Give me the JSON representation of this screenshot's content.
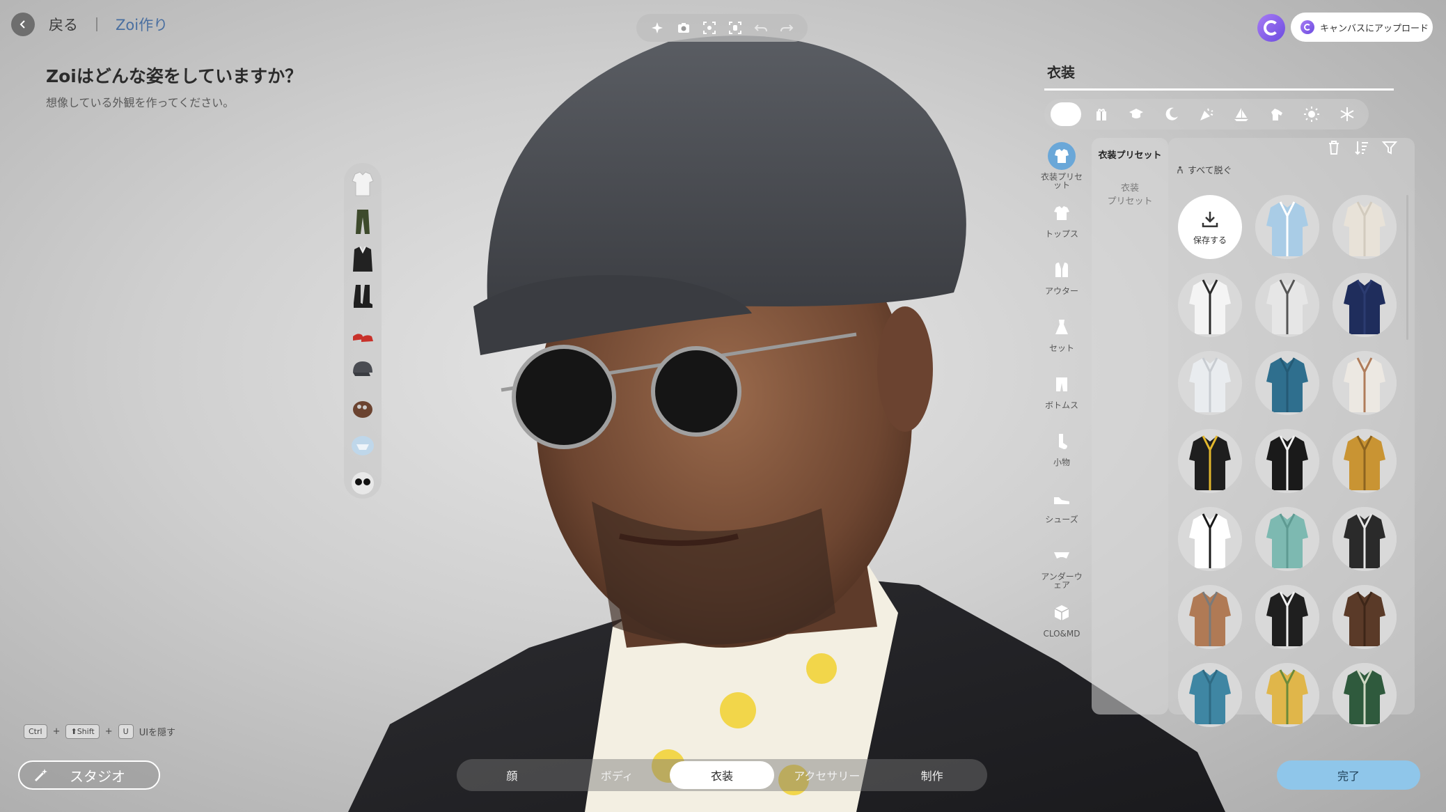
{
  "nav": {
    "back_label": "戻る",
    "crumb": "Zoi作り"
  },
  "heading": {
    "title": "Zoiはどんな姿をしていますか？",
    "subtitle": "想像している外観を作ってください。"
  },
  "toolbar": {
    "tools": [
      "sparkle-icon",
      "camera-icon",
      "focus-face-icon",
      "focus-body-icon",
      "undo-icon",
      "redo-icon"
    ]
  },
  "top_right": {
    "upload_label": "キャンバスにアップロード"
  },
  "item_strip": {
    "items": [
      "shirt",
      "pants",
      "jacket",
      "boots",
      "shoes",
      "cap",
      "gloves",
      "underwear",
      "sunglasses"
    ]
  },
  "shortcut": {
    "keys": [
      "Ctrl",
      "⬆Shift",
      "U"
    ],
    "plus": "+",
    "action": "UIを隠す"
  },
  "studio": {
    "label": "スタジオ"
  },
  "bottom_tabs": {
    "tabs": [
      "顔",
      "ボディ",
      "衣装",
      "アクセサリー",
      "制作"
    ],
    "active_index": 2
  },
  "done": {
    "label": "完了"
  },
  "panel": {
    "title": "衣装",
    "filters": [
      "magic-wand-icon",
      "gift-icon",
      "graduation-cap-icon",
      "moon-icon",
      "party-icon",
      "sailboat-icon",
      "horse-icon",
      "sun-icon",
      "snowflake-icon"
    ],
    "categories": [
      {
        "label": "衣装プリセット",
        "icon": "outfit-preset-icon"
      },
      {
        "label": "トップス",
        "icon": "tshirt-icon"
      },
      {
        "label": "アウター",
        "icon": "outer-icon"
      },
      {
        "label": "セット",
        "icon": "dress-icon"
      },
      {
        "label": "ボトムス",
        "icon": "pants-icon"
      },
      {
        "label": "小物",
        "icon": "sock-icon"
      },
      {
        "label": "シューズ",
        "icon": "shoe-icon"
      },
      {
        "label": "アンダーウェア",
        "icon": "underwear-icon"
      },
      {
        "label": "CLO&MD",
        "icon": "clo-cube-icon"
      }
    ],
    "subcategories": [
      "衣装プリセット",
      "衣装\nプリセット"
    ],
    "undress_label": "すべて脱ぐ",
    "save_label": "保存する"
  },
  "outfit_tiles": [
    {
      "name": "light-blue-denim-shirt",
      "color": "#a9cce6",
      "accent": "#ffffff"
    },
    {
      "name": "cream-knit-sweater",
      "color": "#e8e2d8",
      "accent": "#d2cbbe"
    },
    {
      "name": "white-tee-dark-pants",
      "color": "#f4f4f4",
      "accent": "#2b2b2b"
    },
    {
      "name": "baysider-8-tank",
      "color": "#e6e6e6",
      "accent": "#555555"
    },
    {
      "name": "navy-tee",
      "color": "#1f2d5c",
      "accent": "#2b3b70"
    },
    {
      "name": "light-henley",
      "color": "#e9ecef",
      "accent": "#c8ccd1"
    },
    {
      "name": "teal-baseball-shirt",
      "color": "#2f6f8e",
      "accent": "#245a75"
    },
    {
      "name": "free-spirit-tee",
      "color": "#ece8e2",
      "accent": "#b07c5a"
    },
    {
      "name": "black-jersey-yellow",
      "color": "#1e1e1e",
      "accent": "#e3b72c"
    },
    {
      "name": "varsity-jacket",
      "color": "#1a1a1a",
      "accent": "#f2f2f2"
    },
    {
      "name": "mustard-jacket",
      "color": "#c99433",
      "accent": "#8d6420"
    },
    {
      "name": "striped-rugby",
      "color": "#ffffff",
      "accent": "#1a1a1a"
    },
    {
      "name": "mint-camp-shirt",
      "color": "#7db9b1",
      "accent": "#5e9a92"
    },
    {
      "name": "black-hoodie-jacket",
      "color": "#2a2a2a",
      "accent": "#e6e6e6"
    },
    {
      "name": "bare-torso",
      "color": "#b07a55",
      "accent": "#7a7a7a"
    },
    {
      "name": "black-open-jacket",
      "color": "#1f1f1f",
      "accent": "#f0f0f0"
    },
    {
      "name": "brown-blazer",
      "color": "#5a3a28",
      "accent": "#3d2618"
    },
    {
      "name": "teal-track-jacket",
      "color": "#3f86a3",
      "accent": "#2e6a83"
    },
    {
      "name": "yellow-floral-shirt",
      "color": "#e0b64a",
      "accent": "#6b8a3a"
    },
    {
      "name": "green-tropical-shirt",
      "color": "#2f5a3d",
      "accent": "#cfd8c4"
    }
  ],
  "colors": {
    "accent_blue": "#6aa7d8",
    "done_button": "#8fc6ea",
    "breadcrumb": "#4a6fa0"
  }
}
